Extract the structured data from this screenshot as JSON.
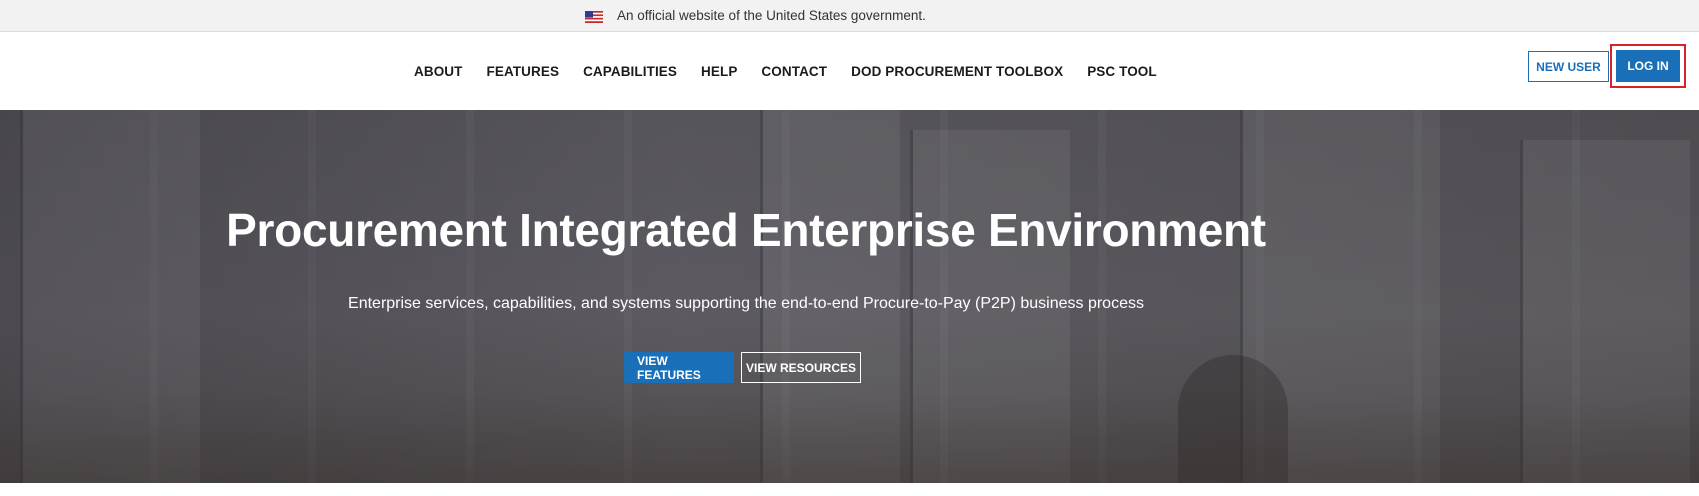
{
  "gov_banner": {
    "text": "An official website of the United States government.",
    "flag_icon": "us-flag-icon"
  },
  "nav": {
    "items": [
      {
        "label": "ABOUT"
      },
      {
        "label": "FEATURES"
      },
      {
        "label": "CAPABILITIES"
      },
      {
        "label": "HELP"
      },
      {
        "label": "CONTACT"
      },
      {
        "label": "DOD PROCUREMENT TOOLBOX"
      },
      {
        "label": "PSC TOOL"
      }
    ]
  },
  "auth": {
    "new_user_label": "NEW USER",
    "login_label": "LOG IN"
  },
  "hero": {
    "title": "Procurement Integrated Enterprise Environment",
    "subtitle": "Enterprise services, capabilities, and systems supporting the end-to-end Procure-to-Pay (P2P) business process",
    "primary_button": "VIEW FEATURES",
    "secondary_button": "VIEW RESOURCES"
  },
  "colors": {
    "accent": "#1a70b8",
    "highlight": "#d8202a",
    "banner_bg": "#f2f2f2"
  }
}
